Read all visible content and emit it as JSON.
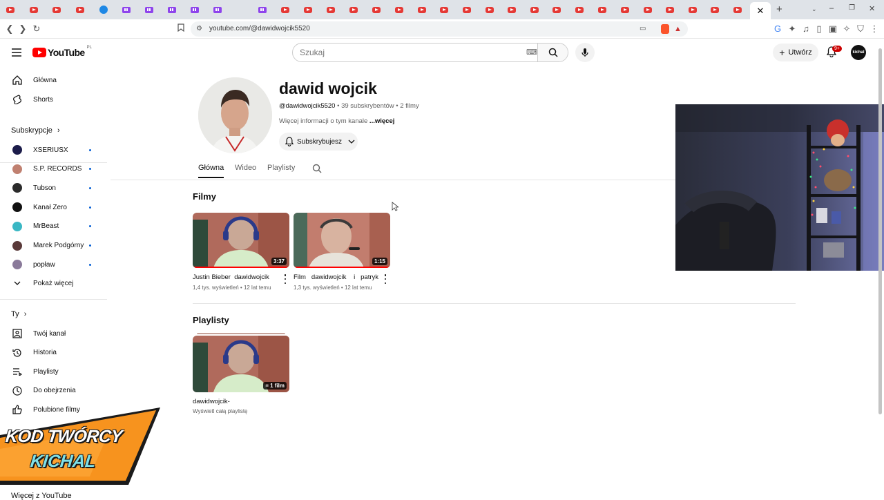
{
  "browser": {
    "url": "youtube.com/@dawidwojcik5520",
    "active_tab_close": "✕",
    "new_tab": "+"
  },
  "header": {
    "logo_text": "YouTube",
    "region": "PL",
    "search_placeholder": "Szukaj",
    "create_label": "Utwórz",
    "notifications_badge": "9+",
    "avatar_text": "kichal"
  },
  "sidebar": {
    "main": [
      {
        "label": "Główna",
        "icon": "home-icon"
      },
      {
        "label": "Shorts",
        "icon": "shorts-icon"
      }
    ],
    "subscriptions_title": "Subskrypcje",
    "subscriptions": [
      {
        "label": "XSERIUSX",
        "color": "#1c1c4a"
      },
      {
        "label": "S.P. RECORDS",
        "color": "#c08070"
      },
      {
        "label": "Tubson",
        "color": "#2b2b2b"
      },
      {
        "label": "Kanał Zero",
        "color": "#111111"
      },
      {
        "label": "MrBeast",
        "color": "#3ab7c4"
      },
      {
        "label": "Marek Podgórny",
        "color": "#5a3a3a"
      },
      {
        "label": "popław",
        "color": "#8a7a9a"
      }
    ],
    "show_more": "Pokaż więcej",
    "you_title": "Ty",
    "you_items": [
      {
        "label": "Twój kanał",
        "icon": "your-channel-icon"
      },
      {
        "label": "Historia",
        "icon": "history-icon"
      },
      {
        "label": "Playlisty",
        "icon": "playlists-icon"
      },
      {
        "label": "Do obejrzenia",
        "icon": "watch-later-icon"
      },
      {
        "label": "Polubione filmy",
        "icon": "liked-icon"
      }
    ],
    "more_from_youtube": "Więcej z YouTube"
  },
  "channel": {
    "name": "dawid wojcik",
    "handle": "@dawidwojcik5520",
    "meta_rest": " • 39 subskrybentów • 2 filmy",
    "desc": "Więcej informacji o tym kanale",
    "desc_more": " ...więcej",
    "subscribe_label": "Subskrybujesz",
    "tabs": [
      "Główna",
      "Wideo",
      "Playlisty"
    ]
  },
  "videos_section": {
    "title": "Filmy",
    "videos": [
      {
        "title": "Justin Bieber  dawidwojcik",
        "meta": "1,4 tys. wyświetleń • 12 lat temu",
        "duration": "3:37"
      },
      {
        "title": "Film   dawidwojcik    i   patryk",
        "meta": "1,3 tys. wyświetleń • 12 lat temu",
        "duration": "1:15"
      }
    ]
  },
  "playlists_section": {
    "title": "Playlisty",
    "playlist": {
      "title": "dawidwojcik-",
      "link": "Wyświetl całą playlistę",
      "count": "1 film"
    }
  },
  "promo": {
    "line1": "KOD TWÓRCY",
    "line2": "KICHAL",
    "color_orange": "#f7931e",
    "color_cyan": "#7ee0e8"
  },
  "colors": {
    "yt_red": "#ff0000",
    "link_blue": "#065fd4"
  }
}
